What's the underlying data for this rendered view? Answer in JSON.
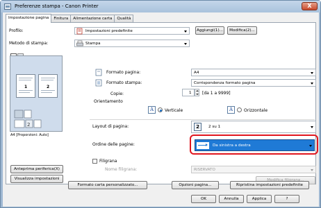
{
  "window": {
    "title": "Preferenze stampa - Canon Printer",
    "close_label": "X"
  },
  "tabs": [
    {
      "label": "Impostazione pagina",
      "active": true
    },
    {
      "label": "Finitura",
      "active": false
    },
    {
      "label": "Alimentazione carta",
      "active": false
    },
    {
      "label": "Qualità",
      "active": false
    }
  ],
  "profile": {
    "label": "Profilo:",
    "value": "Impostazioni predefinite",
    "add_button": "Aggiungi(1)...",
    "edit_button": "Modifica(2)..."
  },
  "output_method": {
    "label": "Metodo di stampa:",
    "value": "Stampa"
  },
  "preview": {
    "pages": [
      "1",
      "2"
    ],
    "caption": "A4 [Proporzioni: Auto]",
    "preview_button": "Anteprima periferica(X)",
    "view_settings_button": "Visualizza impostazioni"
  },
  "page_size": {
    "label": "Formato pagina:",
    "value": "A4"
  },
  "output_size": {
    "label": "Formato stampa:",
    "value": "Corrispondenza formato pagina"
  },
  "copies": {
    "label": "Copie:",
    "value": "1",
    "range": "[da 1 a 9999]"
  },
  "orientation": {
    "label": "Orientamento",
    "portrait": "Verticale",
    "landscape": "Orizzontale",
    "selected": "portrait"
  },
  "page_layout": {
    "label": "Layout di pagina:",
    "value": "2 su 1",
    "icon_number": "2"
  },
  "page_order": {
    "label": "Ordine delle pagine:",
    "value": "Da sinistra a destra"
  },
  "watermark": {
    "label": "Filigrana",
    "name_label": "Nome filigrana:",
    "name_value": "RISERVATO",
    "edit_button": "Modifica filigrana..."
  },
  "bottom_buttons": {
    "custom_paper": "Formato carta personalizzato...",
    "page_options": "Opzioni pagina...",
    "restore": "Ripristina impostazioni predefinite"
  },
  "dialog_buttons": {
    "ok": "OK",
    "cancel": "Annulla",
    "apply": "Applica",
    "help": "?"
  },
  "colors": {
    "highlight": "#e0161e",
    "selection": "#1f7ad6"
  }
}
